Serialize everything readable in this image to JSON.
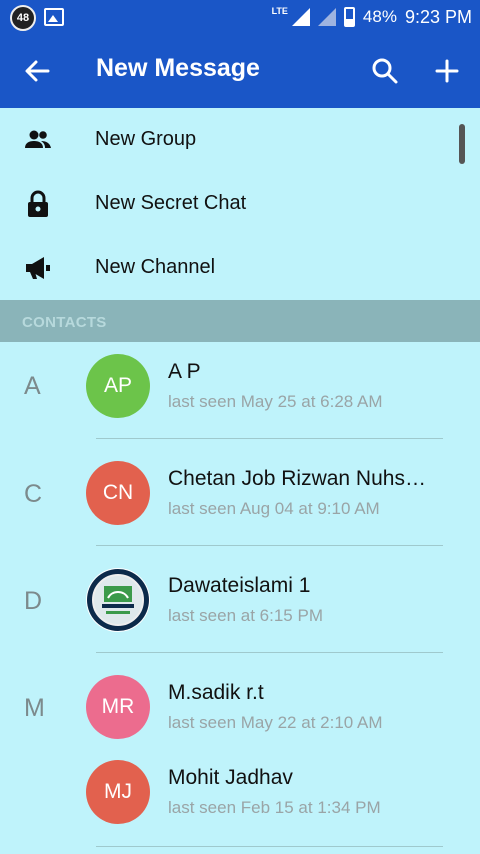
{
  "status_bar": {
    "notification_count": "48",
    "network": "LTE",
    "battery": "48%",
    "time": "9:23 PM"
  },
  "app_bar": {
    "title": "New Message"
  },
  "menu": [
    {
      "label": "New Group",
      "icon": "group-icon"
    },
    {
      "label": "New Secret Chat",
      "icon": "lock-icon"
    },
    {
      "label": "New Channel",
      "icon": "megaphone-icon"
    }
  ],
  "section": {
    "label": "CONTACTS"
  },
  "contacts": [
    {
      "letter": "A",
      "initials": "AP",
      "name": "A P",
      "status": "last seen May 25 at 6:28 AM",
      "color": "#6cc44a"
    },
    {
      "letter": "C",
      "initials": "CN",
      "name": "Chetan Job Rizwan Nuhs…",
      "status": "last seen Aug 04 at 9:10 AM",
      "color": "#e2614e"
    },
    {
      "letter": "D",
      "initials": "",
      "name": "Dawateislami 1",
      "status": "last seen at 6:15 PM",
      "color": "#0c2a4a"
    },
    {
      "letter": "M",
      "initials": "MR",
      "name": "M.sadik r.t",
      "status": "last seen May 22 at 2:10 AM",
      "color": "#ec6c8e"
    },
    {
      "letter": "",
      "initials": "MJ",
      "name": "Mohit Jadhav",
      "status": "last seen Feb 15 at 1:34 PM",
      "color": "#e2614e"
    }
  ],
  "colors": {
    "primary": "#1a56c7",
    "background": "#bff3fb",
    "section_bg": "#8ab4b9"
  }
}
